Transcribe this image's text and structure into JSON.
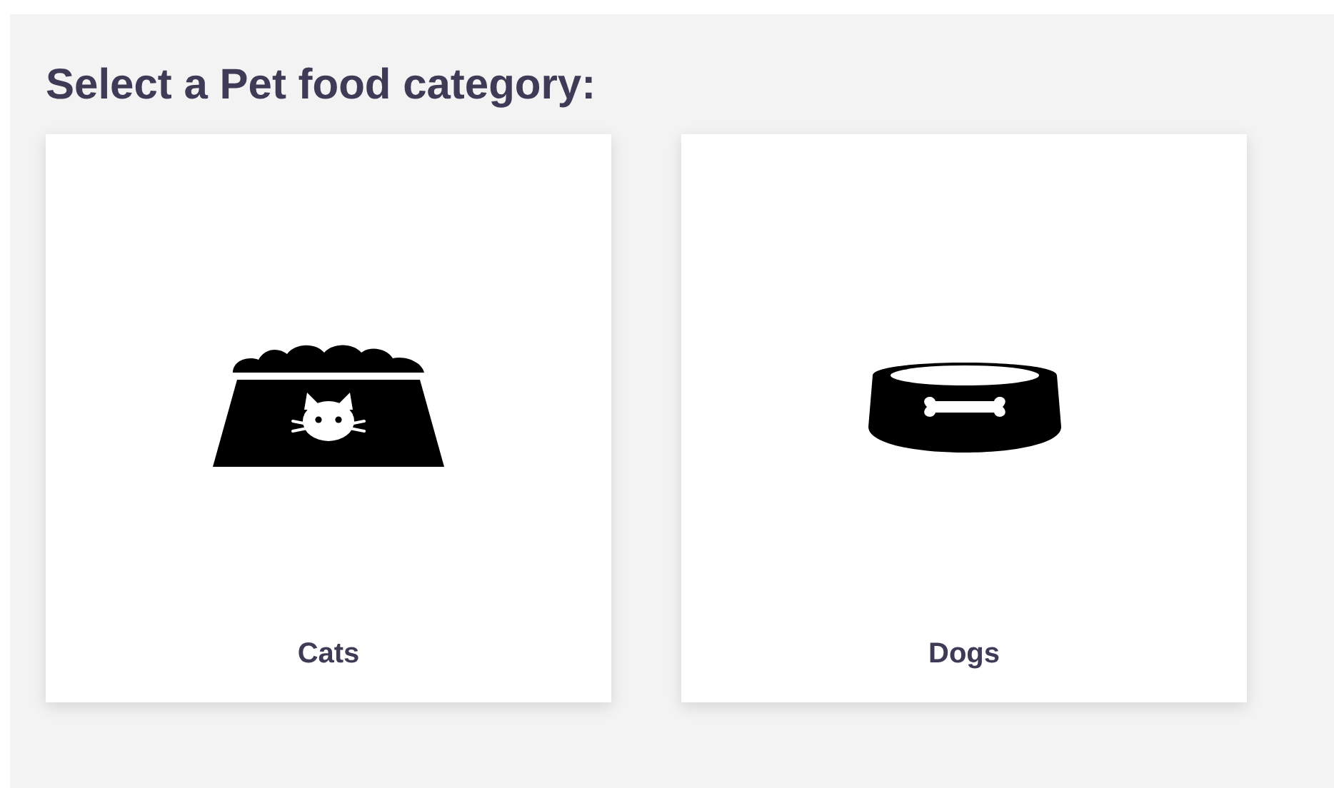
{
  "heading": "Select a Pet food category:",
  "categories": [
    {
      "kind": "cat-food",
      "label": "Cats"
    },
    {
      "kind": "dog-food",
      "label": "Dogs"
    }
  ]
}
